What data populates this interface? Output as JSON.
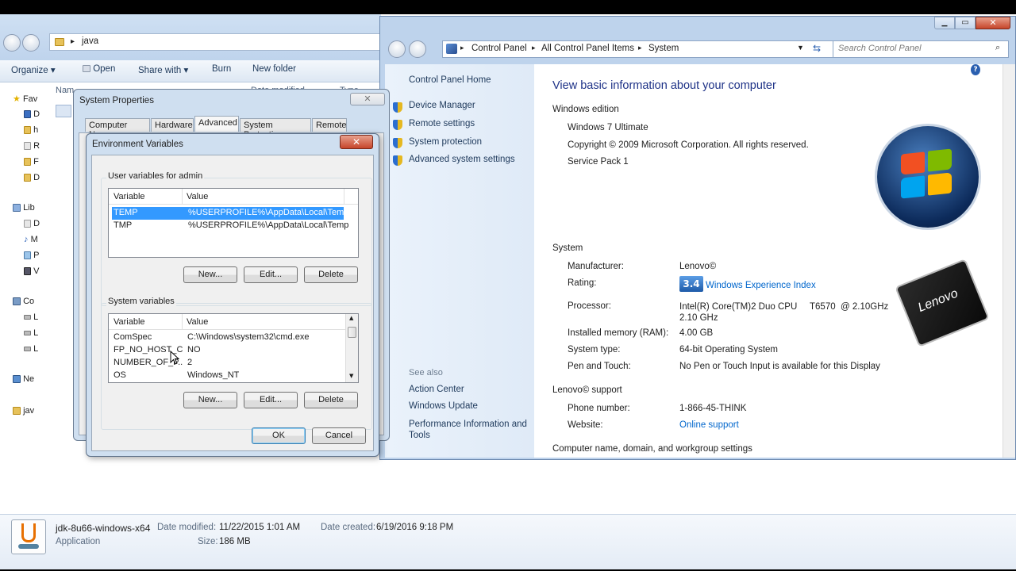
{
  "explorer": {
    "breadcrumb": "java",
    "toolbar": {
      "organize": "Organize",
      "open": "Open",
      "share_with": "Share with",
      "burn": "Burn",
      "new_folder": "New folder"
    },
    "columns": {
      "name": "Nam",
      "date_modified": "Date modified",
      "type": "Type"
    },
    "nav": [
      {
        "label": "Fav",
        "top": 0
      },
      {
        "label": "D"
      },
      {
        "label": "h"
      },
      {
        "label": "R"
      },
      {
        "label": "F"
      },
      {
        "label": "D"
      },
      {
        "label": "Lib"
      },
      {
        "label": "D"
      },
      {
        "label": "M"
      },
      {
        "label": "P"
      },
      {
        "label": "V"
      },
      {
        "label": "Co"
      },
      {
        "label": "L"
      },
      {
        "label": "L"
      },
      {
        "label": "L"
      },
      {
        "label": "Ne"
      },
      {
        "label": "jav"
      }
    ],
    "details": {
      "filename": "jdk-8u66-windows-x64",
      "type": "Application",
      "date_modified_label": "Date modified:",
      "date_modified": "11/22/2015 1:01 AM",
      "size_label": "Size:",
      "size": "186 MB",
      "date_created_label": "Date created:",
      "date_created": "6/19/2016 9:18 PM"
    }
  },
  "control_panel": {
    "breadcrumb": [
      "Control Panel",
      "All Control Panel Items",
      "System"
    ],
    "search_placeholder": "Search Control Panel",
    "side": {
      "home": "Control Panel Home",
      "links": [
        "Device Manager",
        "Remote settings",
        "System protection",
        "Advanced system settings"
      ],
      "see_also": "See also",
      "see_also_links": [
        "Action Center",
        "Windows Update",
        "Performance Information and Tools"
      ]
    },
    "main": {
      "heading": "View basic information about your computer",
      "windows_edition": "Windows edition",
      "edition": "Windows 7 Ultimate",
      "copyright": "Copyright © 2009 Microsoft Corporation.  All rights reserved.",
      "service_pack": "Service Pack 1",
      "system": "System",
      "rows": [
        {
          "k": "Manufacturer:",
          "v": "Lenovo©"
        },
        {
          "k": "Rating:",
          "v": "Windows Experience Index",
          "badge": "3.4"
        },
        {
          "k": "Processor:",
          "v": "Intel(R) Core(TM)2 Duo CPU     T6570  @ 2.10GHz   2.10 GHz"
        },
        {
          "k": "Installed memory (RAM):",
          "v": "4.00 GB"
        },
        {
          "k": "System type:",
          "v": "64-bit Operating System"
        },
        {
          "k": "Pen and Touch:",
          "v": "No Pen or Touch Input is available for this Display"
        }
      ],
      "support": "Lenovo© support",
      "phone_label": "Phone number:",
      "phone": "1-866-45-THINK",
      "website_label": "Website:",
      "website": "Online support",
      "computer_name": "Computer name, domain, and workgroup settings",
      "logo_text": "Lenovo"
    }
  },
  "system_properties": {
    "title": "System Properties",
    "tabs": [
      "Computer Name",
      "Hardware",
      "Advanced",
      "System Protection",
      "Remote"
    ]
  },
  "env_vars": {
    "title": "Environment Variables",
    "user_group": "User variables for admin",
    "system_group": "System variables",
    "col_variable": "Variable",
    "col_value": "Value",
    "user_vars": [
      {
        "name": "TEMP",
        "value": "%USERPROFILE%\\AppData\\Local\\Temp"
      },
      {
        "name": "TMP",
        "value": "%USERPROFILE%\\AppData\\Local\\Temp"
      }
    ],
    "system_vars": [
      {
        "name": "ComSpec",
        "value": "C:\\Windows\\system32\\cmd.exe"
      },
      {
        "name": "FP_NO_HOST_C...",
        "value": "NO"
      },
      {
        "name": "NUMBER_OF_P...",
        "value": "2"
      },
      {
        "name": "OS",
        "value": "Windows_NT"
      }
    ],
    "new_btn": "New...",
    "edit_btn": "Edit...",
    "delete_btn": "Delete",
    "ok_btn": "OK",
    "cancel_btn": "Cancel"
  }
}
